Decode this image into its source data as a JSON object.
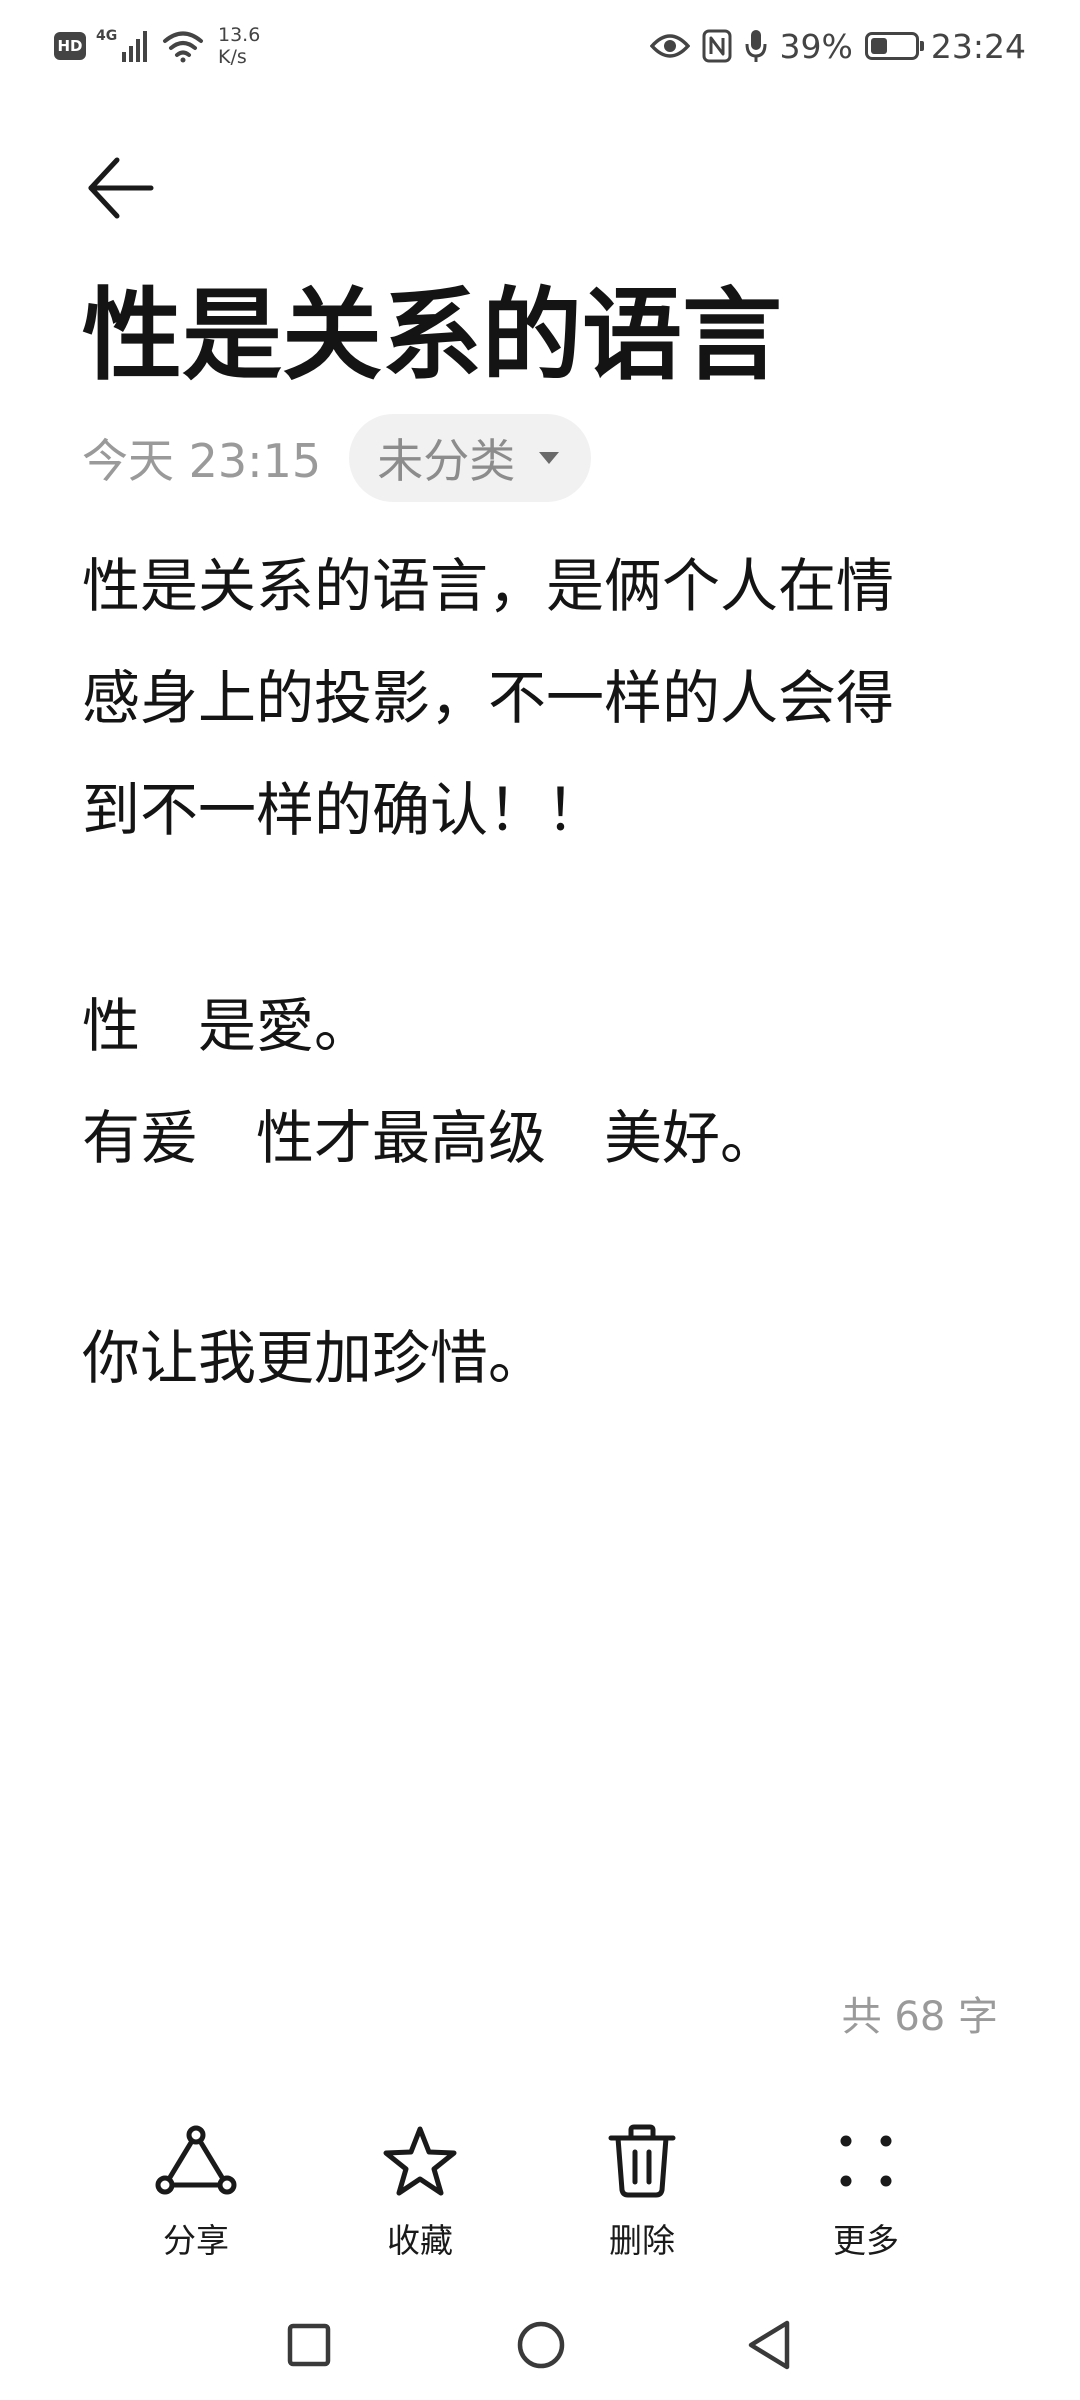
{
  "status_bar": {
    "hd_label": "HD",
    "network_type": "4G",
    "speed_value": "13.6",
    "speed_unit": "K/s",
    "battery_percent": "39%",
    "battery_level": 0.39,
    "time": "23:24"
  },
  "header": {
    "title": "性是关系的语言",
    "date": "今天 23:15",
    "category": "未分类"
  },
  "body": {
    "lines": [
      "性是关系的语言，是俩个人在情",
      "感身上的投影，不一样的人会得",
      "到不一样的确认！！",
      "",
      "性　是愛。",
      "有爰　性才最高级　美好。",
      "",
      "你让我更加珍惜。"
    ]
  },
  "word_count": "共 68 字",
  "toolbar": {
    "share_label": "分享",
    "favorite_label": "收藏",
    "delete_label": "删除",
    "more_label": "更多"
  }
}
